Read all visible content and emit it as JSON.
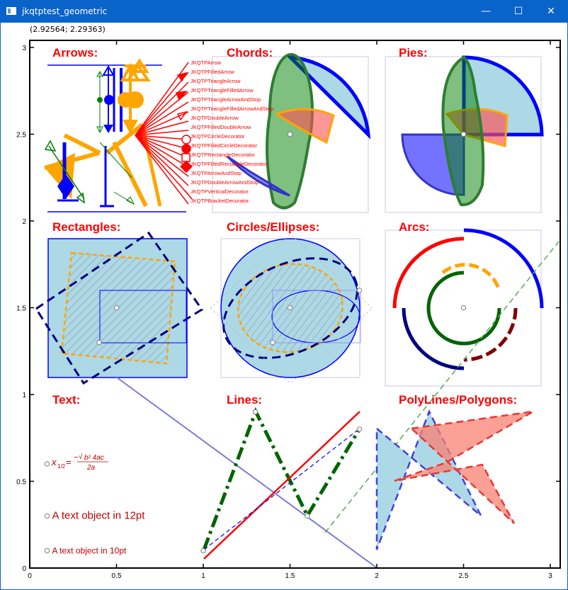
{
  "window": {
    "title": "jkqtptest_geometric",
    "minimize": "—",
    "maximize": "☐",
    "close": "✕"
  },
  "mouse_readout": "(2.92564; 2.29363)",
  "colors": {
    "heading": "#ff0000",
    "axis": "#000000",
    "lightblue": "#add8e6",
    "orange": "#ffa500",
    "navy": "#000080",
    "blue": "#0000ff",
    "green": "#006400",
    "salmon": "#fa8072",
    "darkred": "#800000",
    "titlebar": "#0a63c9"
  },
  "chart_data": {
    "type": "scatter",
    "xlim": [
      0,
      3.05
    ],
    "ylim": [
      0,
      3.05
    ],
    "x_ticks": [
      "0",
      "0.5",
      "1",
      "1.5",
      "2",
      "2.5",
      "3"
    ],
    "y_ticks": [
      "0",
      "0.5",
      "1",
      "1.5",
      "2",
      "2.5",
      "3"
    ],
    "grid": false,
    "section_headings": [
      "Arrows:",
      "Chords:",
      "Pies:",
      "Rectangles:",
      "Circles/Ellipses:",
      "Arcs:",
      "Text:",
      "Lines:",
      "PolyLines/Polygons:"
    ],
    "arrow_labels": [
      "JKQTPArrow",
      "JKQTPFilledArrow",
      "JKQTPTriangleArrow",
      "JKQTPTriangleFilledArrow",
      "JKQTPTriangleArrowAndStop",
      "JKQTPTriangleFilledArrowAndStop",
      "JKQTPDoubleArrow",
      "JKQTPFilledDoubleArrow",
      "JKQTPCircleDecorator",
      "JKQTPFilledCircleDecorator",
      "JKQTPRectangleDecorator",
      "JKQTPFilledRectangleDecorator",
      "JKQTPArrowAndStop",
      "JKQTPDoubleArrowAndStop",
      "JKQTPVerticalDecorator",
      "JKQTPBracketDecorator"
    ],
    "text_objects": [
      {
        "text": "A text object in 12pt",
        "x": 0.1,
        "y": 0.3
      },
      {
        "text": "A text object in 10pt",
        "x": 0.1,
        "y": 0.1
      }
    ],
    "formula": {
      "lhs": "x",
      "sub": "1/2",
      "rhs_num": "b² 4ac",
      "rhs_den": "2a",
      "x": 0.1,
      "y": 0.6
    },
    "lines": {
      "thick_dashdot": [
        [
          1.0,
          0.1
        ],
        [
          1.3,
          0.9
        ],
        [
          1.6,
          0.3
        ],
        [
          1.9,
          0.8
        ]
      ],
      "red_line": [
        [
          1.0,
          0.05
        ],
        [
          1.9,
          0.9
        ]
      ],
      "blue_dashed": [
        [
          1.0,
          0.1
        ],
        [
          1.9,
          0.8
        ]
      ],
      "long_blue": [
        [
          0.4,
          1.1
        ],
        [
          2.0,
          -0.05
        ]
      ],
      "green_dashed": [
        [
          1.7,
          0.2
        ],
        [
          3.05,
          1.9
        ]
      ]
    },
    "polygons": {
      "lightblue_dashed": [
        [
          2.0,
          0.8
        ],
        [
          2.6,
          0.3
        ],
        [
          2.3,
          0.9
        ],
        [
          2.0,
          0.1
        ]
      ],
      "salmon_1": [
        [
          2.2,
          0.8
        ],
        [
          2.9,
          0.9
        ],
        [
          2.2,
          0.2
        ],
        [
          2.3,
          0.65
        ]
      ],
      "salmon_2": [
        [
          2.1,
          0.5
        ],
        [
          2.6,
          0.6
        ],
        [
          2.8,
          0.25
        ]
      ]
    },
    "markers": [
      [
        0.1,
        0.6
      ],
      [
        0.1,
        0.3
      ],
      [
        0.1,
        0.1
      ],
      [
        1.0,
        0.1
      ],
      [
        1.3,
        0.9
      ],
      [
        1.6,
        0.3
      ],
      [
        1.9,
        0.8
      ],
      [
        0.5,
        1.5
      ],
      [
        0.4,
        1.3
      ],
      [
        1.5,
        1.5
      ],
      [
        1.4,
        1.3
      ],
      [
        1.9,
        1.6
      ],
      [
        2.5,
        1.5
      ],
      [
        2.5,
        2.5
      ],
      [
        1.5,
        2.5
      ]
    ]
  }
}
